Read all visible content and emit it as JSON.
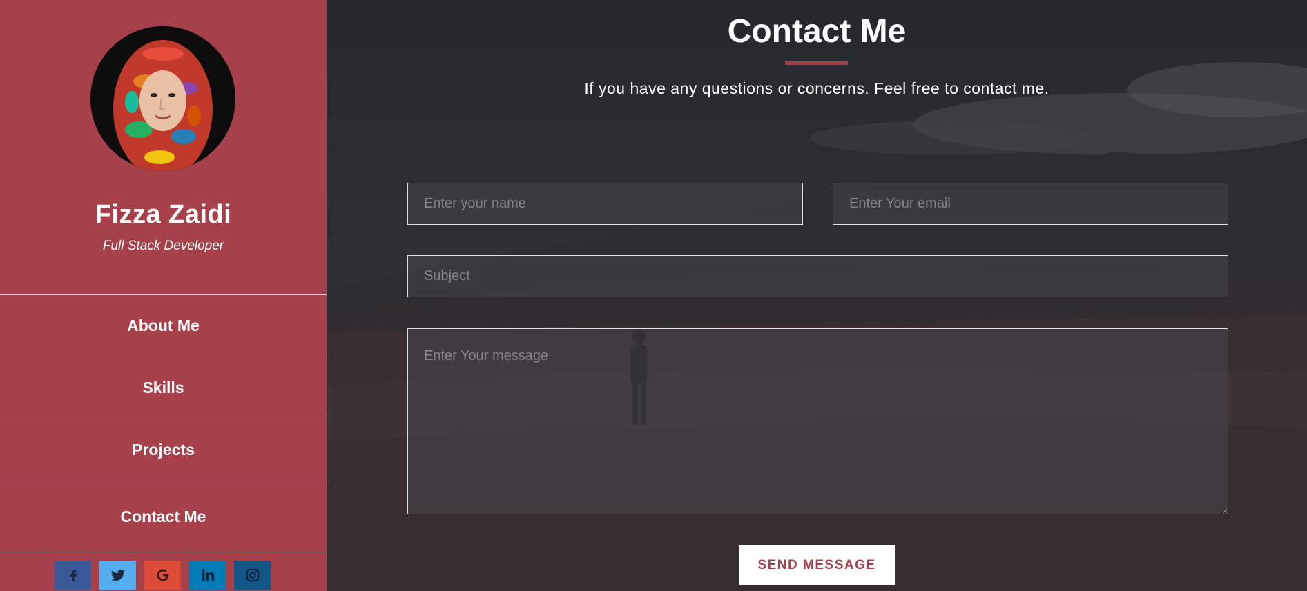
{
  "profile": {
    "name": "Fizza Zaidi",
    "role": "Full Stack Developer"
  },
  "nav": {
    "items": [
      {
        "label": "About Me"
      },
      {
        "label": "Skills"
      },
      {
        "label": "Projects"
      },
      {
        "label": "Contact Me"
      }
    ]
  },
  "social": [
    {
      "icon": "facebook-icon",
      "color": "#3b5998"
    },
    {
      "icon": "twitter-icon",
      "color": "#55acee"
    },
    {
      "icon": "google-icon",
      "color": "#dd4b39"
    },
    {
      "icon": "linkedin-icon",
      "color": "#007bb5"
    },
    {
      "icon": "instagram-icon",
      "color": "#125688"
    }
  ],
  "contact": {
    "title": "Contact Me",
    "subtitle": "If you have any questions or concerns. Feel free to contact me.",
    "name_placeholder": "Enter your name",
    "email_placeholder": "Enter Your email",
    "subject_placeholder": "Subject",
    "message_placeholder": "Enter Your message",
    "send_label": "SEND MESSAGE"
  },
  "colors": {
    "accent": "#a6404b",
    "sidebar_bg": "#a6404b",
    "button_bg": "#ffffff"
  }
}
